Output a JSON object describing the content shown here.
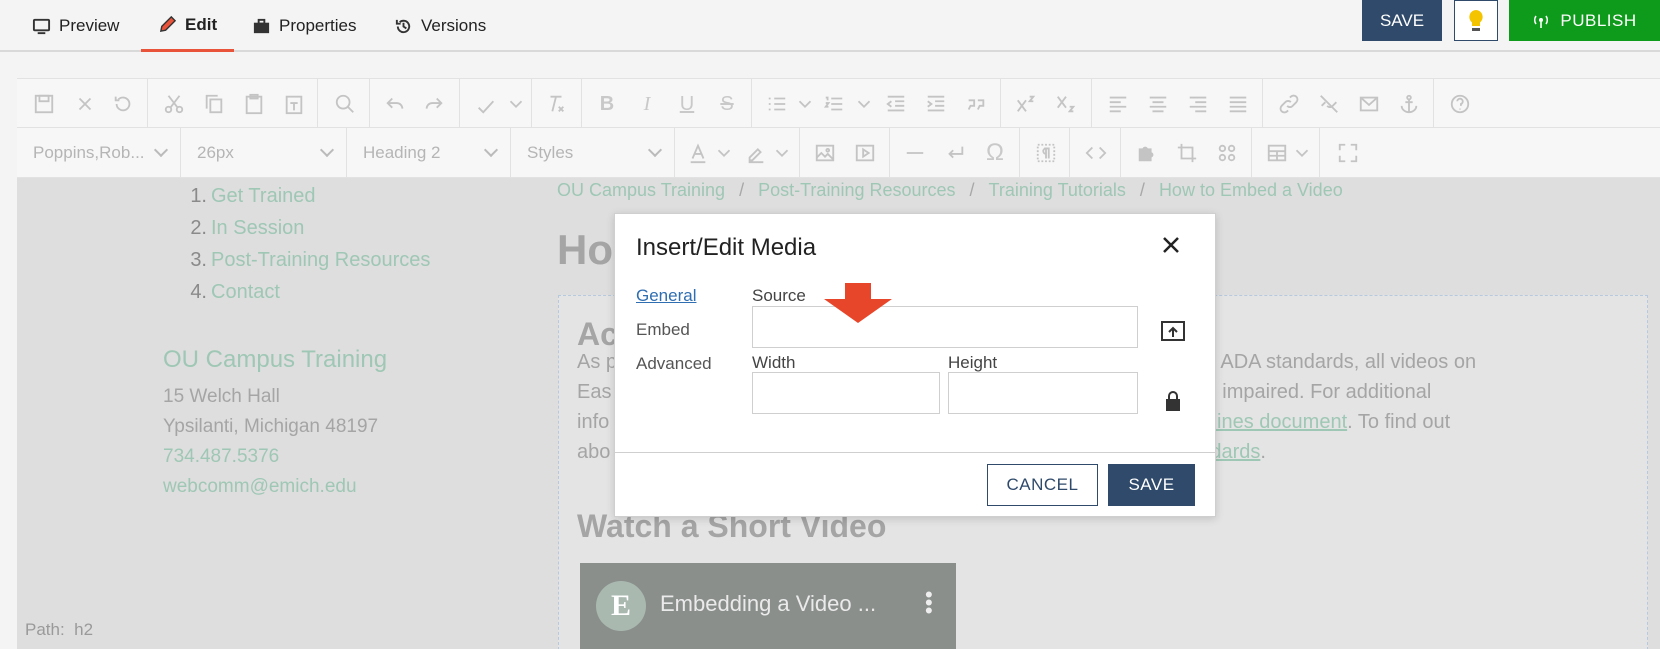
{
  "tabs": [
    {
      "label": "Preview",
      "icon": "monitor-icon"
    },
    {
      "label": "Edit",
      "icon": "pencil-icon",
      "active": true
    },
    {
      "label": "Properties",
      "icon": "toolbox-icon"
    },
    {
      "label": "Versions",
      "icon": "history-icon"
    }
  ],
  "header": {
    "save_label": "SAVE",
    "bulb_icon": "lightbulb-icon",
    "publish_label": "PUBLISH",
    "publish_icon": "broadcast-icon",
    "colors": {
      "save": "#2f4a6b",
      "publish": "#0e9a1a",
      "active_tab": "#e8533a"
    }
  },
  "toolbar": {
    "font_family": "Poppins,Rob...",
    "font_size": "26px",
    "block_format": "Heading 2",
    "styles": "Styles"
  },
  "page": {
    "nav_items": [
      {
        "num": "1.",
        "label": "Get Trained"
      },
      {
        "num": "2.",
        "label": "In Session"
      },
      {
        "num": "3.",
        "label": "Post-Training Resources"
      },
      {
        "num": "4.",
        "label": "Contact"
      }
    ],
    "contact": {
      "title": "OU Campus Training",
      "address1": "15 Welch Hall",
      "address2": "Ypsilanti, Michigan 48197",
      "phone": "734.487.5376",
      "email": "webcomm@emich.edu"
    },
    "breadcrumb": [
      "OU Campus Training",
      "Post-Training Resources",
      "Training Tutorials",
      "How to Embed a Video"
    ],
    "breadcrumb_sep": "/",
    "heading_partial": "Ho",
    "subheading_partial": "Ac",
    "para_left": [
      "As p",
      "Eas",
      "info",
      "abo"
    ],
    "para_right_1": "ant with ADA standards, all videos on",
    "para_right_2": "hearing impaired. For additional",
    "para_right_3_link": "e guidelines document",
    "para_right_3_tail": ". To find out",
    "para_right_4_link": "ity standards",
    "para_right_4_tail": ".",
    "watch_heading": "Watch a Short Video",
    "video_title": "Embedding a Video ...",
    "video_logo": "E",
    "path_label": "Path:",
    "path_value": "h2"
  },
  "modal": {
    "title": "Insert/Edit Media",
    "tabs": [
      "General",
      "Embed",
      "Advanced"
    ],
    "source_label": "Source",
    "source_value": "",
    "width_label": "Width",
    "width_value": "",
    "height_label": "Height",
    "height_value": "",
    "cancel_label": "CANCEL",
    "save_label": "SAVE"
  }
}
